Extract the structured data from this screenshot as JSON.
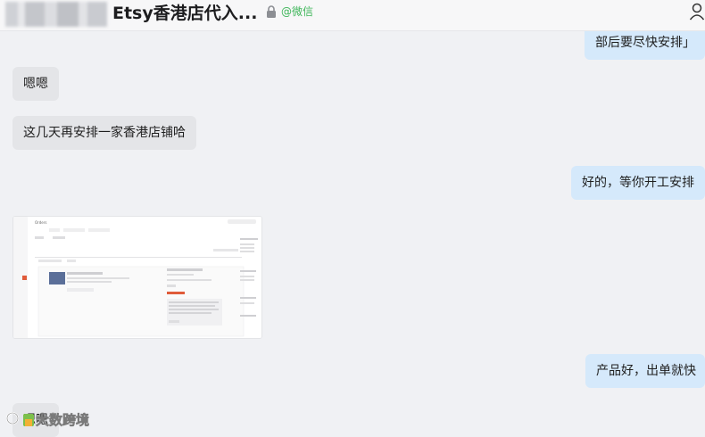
{
  "header": {
    "title": "Etsy香港店代入...",
    "tag": "@微信"
  },
  "messages": [
    {
      "side": "right",
      "text": "部后要尽快安排」"
    },
    {
      "side": "left",
      "text": "嗯嗯"
    },
    {
      "side": "left",
      "text": "这几天再安排一家香港店铺哈"
    },
    {
      "side": "right",
      "text": "好的，等你开工安排"
    },
    {
      "side": "right",
      "text": "产品好，出单就快"
    },
    {
      "side": "left",
      "text": "嗯嗯"
    }
  ],
  "shared_image": {
    "title": "Orders"
  },
  "watermark": {
    "text": "大数跨境"
  },
  "colors": {
    "bubble_left": "#e4e5e8",
    "bubble_right": "#d5e9fb",
    "wechat_green": "#3fb65a",
    "background": "#f0f1f4"
  }
}
